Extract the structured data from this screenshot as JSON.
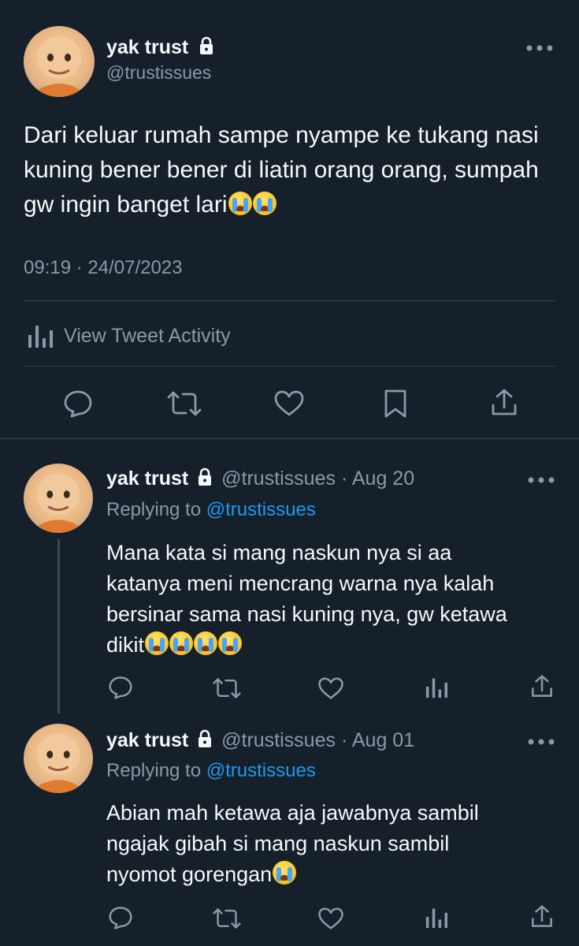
{
  "main_tweet": {
    "author_name": "yak trust",
    "handle": "@trustissues",
    "text": "Dari keluar rumah sampe nyampe ke tukang nasi kuning bener bener di liatin orang orang, sumpah gw ingin banget lari",
    "emoji_count": 2,
    "timestamp": "09:19 · 24/07/2023",
    "activity_label": "View Tweet Activity",
    "actions": [
      "reply-icon",
      "retweet-icon",
      "like-icon",
      "bookmark-icon",
      "share-icon"
    ]
  },
  "replies": [
    {
      "author_name": "yak trust",
      "handle": "@trustissues",
      "separator": "·",
      "date": "Aug 20",
      "replying_prefix": "Replying to",
      "replying_handle": "@trustissues",
      "text_line1": "Mana kata si mang naskun nya si aa",
      "text_line2": "katanya meni mencrang warna nya kalah",
      "text_line3": "bersinar sama nasi kuning nya, gw ketawa",
      "text_line4": "dikit",
      "emoji_count": 4
    },
    {
      "author_name": "yak trust",
      "handle": "@trustissues",
      "separator": "·",
      "date": "Aug 01",
      "replying_prefix": "Replying to",
      "replying_handle": "@trustissues",
      "text_line1": "Abian mah ketawa aja jawabnya sambil",
      "text_line2": "ngajak gibah si mang naskun sambil",
      "text_line3": "nyomot gorengan",
      "emoji_count": 1
    }
  ],
  "colors": {
    "background": "#15202b",
    "text": "#f7f9f9",
    "muted": "#8b98a5",
    "link": "#1d9bf0",
    "divider": "#38444d"
  }
}
